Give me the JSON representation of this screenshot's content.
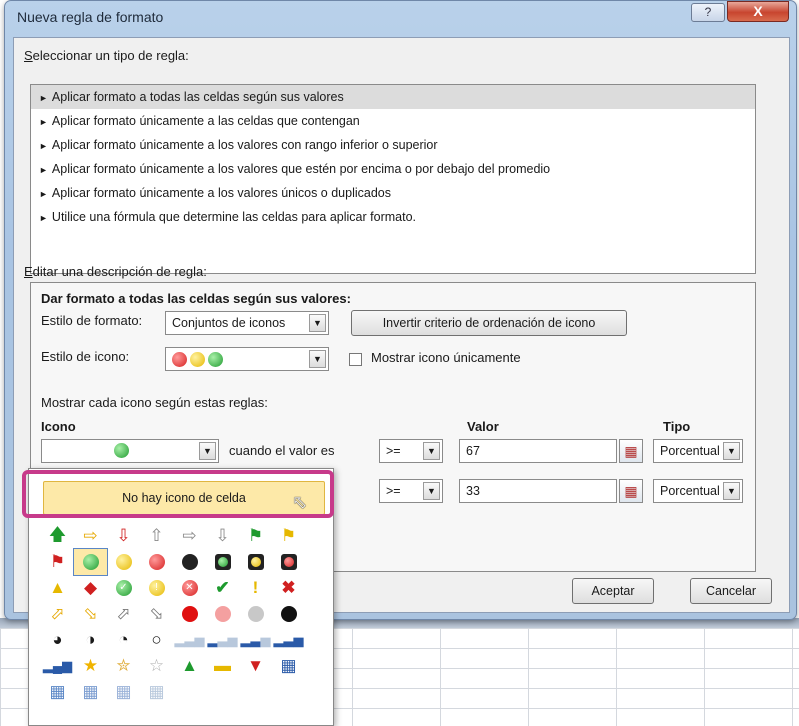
{
  "dialog": {
    "title": "Nueva regla de formato",
    "help_label": "?",
    "close_label": "X"
  },
  "rule_types": {
    "label_u": "S",
    "label_rest": "eleccionar un tipo de regla:",
    "items": [
      "Aplicar formato a todas las celdas según sus valores",
      "Aplicar formato únicamente a las celdas que contengan",
      "Aplicar formato únicamente a los valores con rango inferior o superior",
      "Aplicar formato únicamente a los valores que estén por encima o por debajo del promedio",
      "Aplicar formato únicamente a los valores únicos o duplicados",
      "Utilice una fórmula que determine las celdas para aplicar formato."
    ],
    "selected_index": 0
  },
  "description": {
    "label_u": "E",
    "label_rest": "ditar una descripción de regla:",
    "heading": "Dar formato a todas las celdas según sus valores:",
    "format_style_label": "Estilo de formato:",
    "format_style_value": "Conjuntos de iconos",
    "reverse_button": "Invertir criterio de ordenación de icono",
    "icon_style_label": "Estilo de icono:",
    "show_icon_only_label": "Mostrar icono únicamente",
    "show_icon_only_checked": false,
    "rules_label": "Mostrar cada icono según estas reglas:",
    "col_icon": "Icono",
    "col_value": "Valor",
    "col_type": "Tipo",
    "when_value_is": "cuando el valor es",
    "rows": [
      {
        "operator": ">=",
        "value": "67",
        "type": "Porcentual"
      },
      {
        "operator": ">=",
        "value": "33",
        "type": "Porcentual"
      }
    ]
  },
  "icon_popup": {
    "no_icon_label": "No hay icono de celda",
    "icons": [
      "arrow-up-green-icon",
      "arrow-right-yellow-icon",
      "arrow-down-red-icon",
      "arrow-up-gray-icon",
      "arrow-right-gray-icon",
      "arrow-down-gray-icon",
      "flag-green-icon",
      "flag-yellow-icon",
      "flag-red-icon",
      "circle-green-icon",
      "circle-yellow-icon",
      "circle-red-icon",
      "circle-black-icon",
      "traffic-light-green-icon",
      "traffic-light-yellow-icon",
      "traffic-light-red-icon",
      "triangle-yellow-icon",
      "diamond-red-icon",
      "check-circle-green-icon",
      "exclamation-circle-yellow-icon",
      "x-circle-red-icon",
      "check-green-icon",
      "exclamation-yellow-icon",
      "x-red-icon",
      "arrow-up-right-yellow-icon",
      "arrow-down-right-yellow-icon",
      "arrow-up-right-gray-icon",
      "arrow-down-right-gray-icon",
      "circle-red-solid-icon",
      "circle-pink-icon",
      "circle-gray-icon",
      "circle-black-solid-icon",
      "quarter-circle-icon",
      "half-circle-icon",
      "three-quarter-circle-icon",
      "empty-circle-icon",
      "signal-bars-1-icon",
      "signal-bars-2-icon",
      "signal-bars-3-icon",
      "signal-bars-4-icon",
      "signal-bars-full-icon",
      "star-gold-icon",
      "star-half-icon",
      "star-empty-icon",
      "triangle-up-green-icon",
      "dash-yellow-icon",
      "triangle-down-red-icon",
      "boxes-4-icon",
      "boxes-3-icon",
      "boxes-2-icon",
      "boxes-1-icon",
      "boxes-0-icon"
    ],
    "selected_index": 9
  },
  "footer": {
    "ok_label": "Aceptar",
    "cancel_label": "Cancelar"
  },
  "colors": {
    "title_bar": "#b9d1ea",
    "highlight_border": "#c73a8a",
    "no_icon_bg": "#fde9a8"
  }
}
